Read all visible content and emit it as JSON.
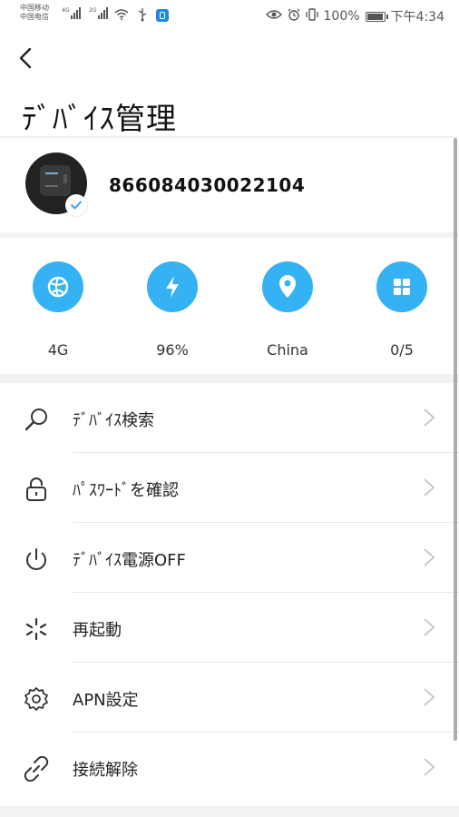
{
  "status_bar": {
    "carrier_1": "中国移动",
    "carrier_2": "中国电信",
    "signal_1_tag": "4G",
    "signal_2_tag": "2G",
    "battery_percent": "100%",
    "time": "下午4:34",
    "battery_level": 1.0
  },
  "header": {
    "back_icon": "chevron-left-icon",
    "title": "ﾃﾞﾊﾞｲｽ管理"
  },
  "device": {
    "id": "866084030022104",
    "verified": true
  },
  "stats": [
    {
      "icon": "globe-icon",
      "label": "4G"
    },
    {
      "icon": "lightning-icon",
      "label": "96%"
    },
    {
      "icon": "location-pin-icon",
      "label": "China"
    },
    {
      "icon": "grid-icon",
      "label": "0/5"
    }
  ],
  "menu": [
    {
      "icon": "search-icon",
      "label": "ﾃﾞﾊﾞｲｽ検索"
    },
    {
      "icon": "lock-icon",
      "label": "ﾊﾟｽﾜｰﾄﾞを確認"
    },
    {
      "icon": "power-icon",
      "label": "ﾃﾞﾊﾞｲｽ電源OFF"
    },
    {
      "icon": "restart-icon",
      "label": "再起動"
    },
    {
      "icon": "gear-icon",
      "label": "APN設定"
    },
    {
      "icon": "unlink-icon",
      "label": "接続解除"
    }
  ],
  "colors": {
    "accent": "#35b2f4",
    "check": "#2d9bef"
  }
}
